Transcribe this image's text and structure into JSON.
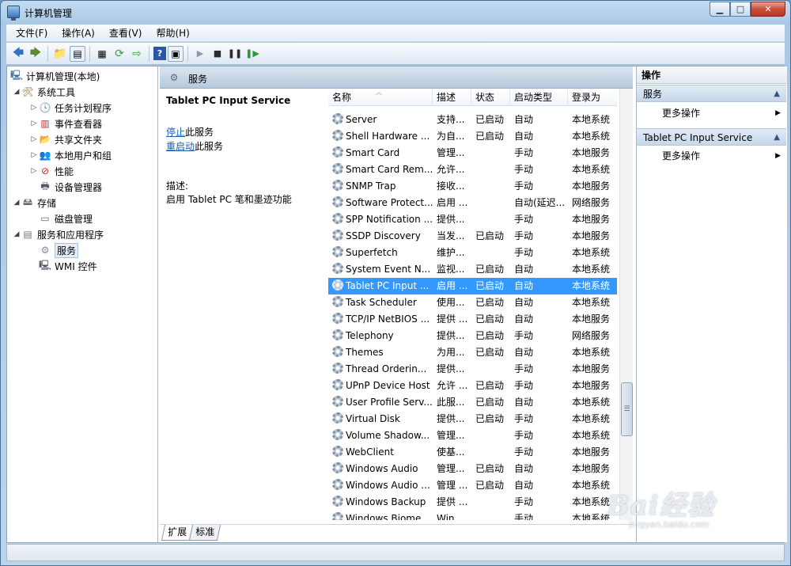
{
  "window": {
    "title": "计算机管理",
    "min": "▁",
    "max": "□",
    "close": "✕"
  },
  "menu": [
    "文件(F)",
    "操作(A)",
    "查看(V)",
    "帮助(H)"
  ],
  "toolbar_icons": [
    "back-icon",
    "forward-icon",
    "up-folder-icon",
    "show-hide-tree-icon",
    "properties-icon",
    "refresh-icon",
    "export-icon",
    "help-icon",
    "view-icon",
    "start-service-icon",
    "stop-service-icon",
    "pause-service-icon",
    "restart-service-icon"
  ],
  "tree": {
    "root": "计算机管理(本地)",
    "system_tools": "系统工具",
    "task_scheduler": "任务计划程序",
    "event_viewer": "事件查看器",
    "shared_folders": "共享文件夹",
    "local_users": "本地用户和组",
    "performance": "性能",
    "device_manager": "设备管理器",
    "storage": "存储",
    "disk_management": "磁盘管理",
    "services_apps": "服务和应用程序",
    "services": "服务",
    "wmi": "WMI 控件"
  },
  "middle": {
    "header": "服务",
    "selected_service": "Tablet PC Input Service",
    "stop_link": "停止",
    "stop_suffix": "此服务",
    "restart_link": "重启动",
    "restart_suffix": "此服务",
    "desc_label": "描述:",
    "desc_text": "启用 Tablet PC 笔和墨迹功能"
  },
  "columns": [
    "名称",
    "描述",
    "状态",
    "启动类型",
    "登录为"
  ],
  "services": [
    {
      "name": "Server",
      "desc": "支持...",
      "status": "已启动",
      "startup": "自动",
      "logon": "本地系统"
    },
    {
      "name": "Shell Hardware ...",
      "desc": "为自...",
      "status": "已启动",
      "startup": "自动",
      "logon": "本地系统"
    },
    {
      "name": "Smart Card",
      "desc": "管理...",
      "status": "",
      "startup": "手动",
      "logon": "本地服务"
    },
    {
      "name": "Smart Card Rem...",
      "desc": "允许...",
      "status": "",
      "startup": "手动",
      "logon": "本地系统"
    },
    {
      "name": "SNMP Trap",
      "desc": "接收...",
      "status": "",
      "startup": "手动",
      "logon": "本地服务"
    },
    {
      "name": "Software Protect...",
      "desc": "启用 ...",
      "status": "",
      "startup": "自动(延迟...",
      "logon": "网络服务"
    },
    {
      "name": "SPP Notification ...",
      "desc": "提供...",
      "status": "",
      "startup": "手动",
      "logon": "本地服务"
    },
    {
      "name": "SSDP Discovery",
      "desc": "当发...",
      "status": "已启动",
      "startup": "手动",
      "logon": "本地服务"
    },
    {
      "name": "Superfetch",
      "desc": "维护...",
      "status": "",
      "startup": "手动",
      "logon": "本地系统"
    },
    {
      "name": "System Event N...",
      "desc": "监视...",
      "status": "已启动",
      "startup": "自动",
      "logon": "本地系统"
    },
    {
      "name": "Tablet PC Input ...",
      "desc": "启用 ...",
      "status": "已启动",
      "startup": "自动",
      "logon": "本地系统"
    },
    {
      "name": "Task Scheduler",
      "desc": "使用...",
      "status": "已启动",
      "startup": "自动",
      "logon": "本地系统"
    },
    {
      "name": "TCP/IP NetBIOS ...",
      "desc": "提供 ...",
      "status": "已启动",
      "startup": "自动",
      "logon": "本地服务"
    },
    {
      "name": "Telephony",
      "desc": "提供...",
      "status": "已启动",
      "startup": "手动",
      "logon": "网络服务"
    },
    {
      "name": "Themes",
      "desc": "为用...",
      "status": "已启动",
      "startup": "自动",
      "logon": "本地系统"
    },
    {
      "name": "Thread Orderin...",
      "desc": "提供...",
      "status": "",
      "startup": "手动",
      "logon": "本地服务"
    },
    {
      "name": "UPnP Device Host",
      "desc": "允许 ...",
      "status": "已启动",
      "startup": "手动",
      "logon": "本地服务"
    },
    {
      "name": "User Profile Serv...",
      "desc": "此服...",
      "status": "已启动",
      "startup": "自动",
      "logon": "本地系统"
    },
    {
      "name": "Virtual Disk",
      "desc": "提供...",
      "status": "已启动",
      "startup": "手动",
      "logon": "本地系统"
    },
    {
      "name": "Volume Shadow...",
      "desc": "管理...",
      "status": "",
      "startup": "手动",
      "logon": "本地系统"
    },
    {
      "name": "WebClient",
      "desc": "使基...",
      "status": "",
      "startup": "手动",
      "logon": "本地服务"
    },
    {
      "name": "Windows Audio",
      "desc": "管理...",
      "status": "已启动",
      "startup": "自动",
      "logon": "本地服务"
    },
    {
      "name": "Windows Audio ...",
      "desc": "管理 ...",
      "status": "已启动",
      "startup": "自动",
      "logon": "本地系统"
    },
    {
      "name": "Windows Backup",
      "desc": "提供 ...",
      "status": "",
      "startup": "手动",
      "logon": "本地系统"
    },
    {
      "name": "Windows Biome...",
      "desc": "Win...",
      "status": "",
      "startup": "手动",
      "logon": "本地系统"
    }
  ],
  "selected_index": 10,
  "tabs": [
    "扩展",
    "标准"
  ],
  "actions": {
    "header": "操作",
    "section1": "服务",
    "section1_more": "更多操作",
    "section2": "Tablet PC Input Service",
    "section2_more": "更多操作"
  },
  "watermark": {
    "brand": "Bai经验",
    "url": "jingyan.baidu.com"
  },
  "colors": {
    "selection": "#3399ff",
    "link": "#1a5fb4"
  }
}
